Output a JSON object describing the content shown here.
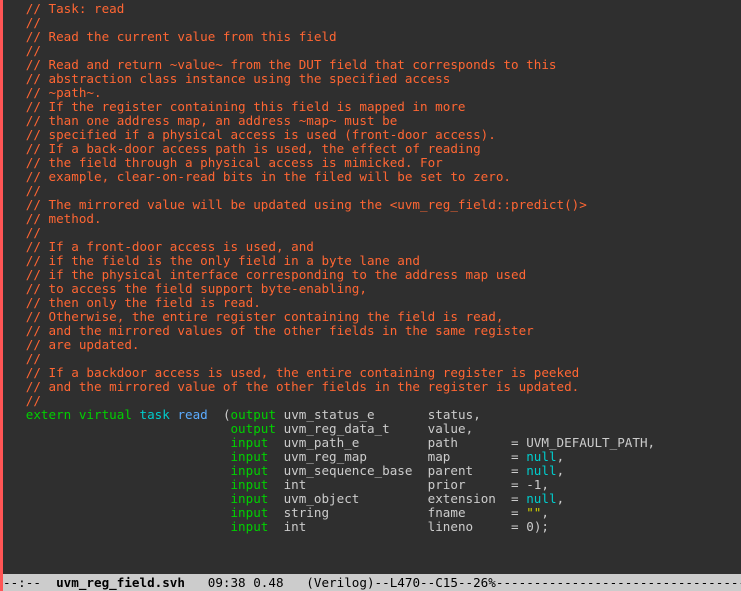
{
  "comments": [
    "// Task: read",
    "//",
    "// Read the current value from this field",
    "//",
    "// Read and return ~value~ from the DUT field that corresponds to this",
    "// abstraction class instance using the specified access",
    "// ~path~.",
    "// If the register containing this field is mapped in more",
    "// than one address map, an address ~map~ must be",
    "// specified if a physical access is used (front-door access).",
    "// If a back-door access path is used, the effect of reading",
    "// the field through a physical access is mimicked. For",
    "// example, clear-on-read bits in the filed will be set to zero.",
    "//",
    "// The mirrored value will be updated using the <uvm_reg_field::predict()>",
    "// method.",
    "//",
    "// If a front-door access is used, and",
    "// if the field is the only field in a byte lane and",
    "// if the physical interface corresponding to the address map used",
    "// to access the field support byte-enabling,",
    "// then only the field is read.",
    "// Otherwise, the entire register containing the field is read,",
    "// and the mirrored values of the other fields in the same register",
    "// are updated.",
    "//",
    "// If a backdoor access is used, the entire containing register is peeked",
    "// and the mirrored value of the other fields in the register is updated.",
    "//"
  ],
  "decl": {
    "kw1": "extern virtual",
    "kw2": "task",
    "name": "read",
    "params": [
      {
        "dir": "output",
        "type": "uvm_status_e",
        "name": "status",
        "eq": "",
        "def": "",
        "comma": ","
      },
      {
        "dir": "output",
        "type": "uvm_reg_data_t",
        "name": "value",
        "eq": "",
        "def": "",
        "comma": ","
      },
      {
        "dir": "input",
        "type": "uvm_path_e",
        "name": "path",
        "eq": " = ",
        "def": "UVM_DEFAULT_PATH",
        "comma": ","
      },
      {
        "dir": "input",
        "type": "uvm_reg_map",
        "name": "map",
        "eq": " = ",
        "def": "null",
        "comma": ","
      },
      {
        "dir": "input",
        "type": "uvm_sequence_base",
        "name": "parent",
        "eq": " = ",
        "def": "null",
        "comma": ","
      },
      {
        "dir": "input",
        "type": "int",
        "name": "prior",
        "eq": " = ",
        "def": "-1",
        "comma": ","
      },
      {
        "dir": "input",
        "type": "uvm_object",
        "name": "extension",
        "eq": " = ",
        "def": "null",
        "comma": ","
      },
      {
        "dir": "input",
        "type": "string",
        "name": "fname",
        "eq": " = ",
        "def": "\"\"",
        "comma": ","
      },
      {
        "dir": "input",
        "type": "int",
        "name": "lineno",
        "eq": " = ",
        "def": "0",
        "comma": ");"
      }
    ]
  },
  "modeline": {
    "prefix": "--:--  ",
    "file": "uvm_reg_field.svh",
    "rest": "   09:38 0.48   (Verilog)--L470--C15--26%",
    "fill": "--------------------------------------------------"
  }
}
